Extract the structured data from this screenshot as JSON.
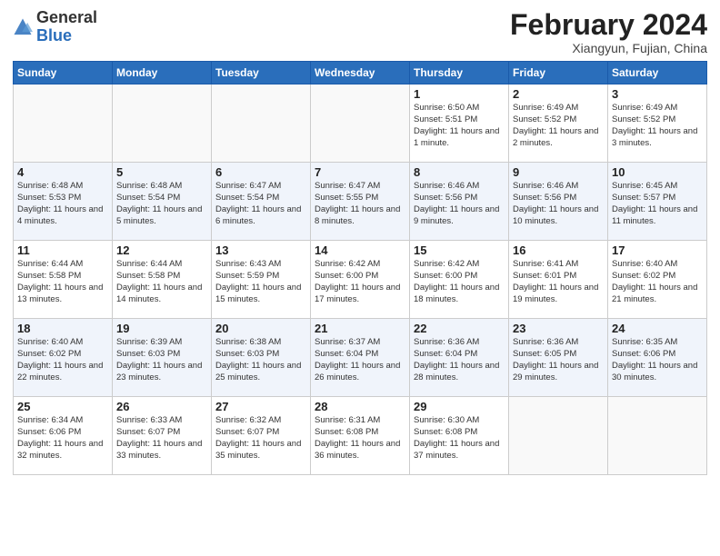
{
  "header": {
    "logo_general": "General",
    "logo_blue": "Blue",
    "month_title": "February 2024",
    "subtitle": "Xiangyun, Fujian, China"
  },
  "weekdays": [
    "Sunday",
    "Monday",
    "Tuesday",
    "Wednesday",
    "Thursday",
    "Friday",
    "Saturday"
  ],
  "weeks": [
    [
      {
        "day": "",
        "info": ""
      },
      {
        "day": "",
        "info": ""
      },
      {
        "day": "",
        "info": ""
      },
      {
        "day": "",
        "info": ""
      },
      {
        "day": "1",
        "info": "Sunrise: 6:50 AM\nSunset: 5:51 PM\nDaylight: 11 hours and 1 minute."
      },
      {
        "day": "2",
        "info": "Sunrise: 6:49 AM\nSunset: 5:52 PM\nDaylight: 11 hours and 2 minutes."
      },
      {
        "day": "3",
        "info": "Sunrise: 6:49 AM\nSunset: 5:52 PM\nDaylight: 11 hours and 3 minutes."
      }
    ],
    [
      {
        "day": "4",
        "info": "Sunrise: 6:48 AM\nSunset: 5:53 PM\nDaylight: 11 hours and 4 minutes."
      },
      {
        "day": "5",
        "info": "Sunrise: 6:48 AM\nSunset: 5:54 PM\nDaylight: 11 hours and 5 minutes."
      },
      {
        "day": "6",
        "info": "Sunrise: 6:47 AM\nSunset: 5:54 PM\nDaylight: 11 hours and 6 minutes."
      },
      {
        "day": "7",
        "info": "Sunrise: 6:47 AM\nSunset: 5:55 PM\nDaylight: 11 hours and 8 minutes."
      },
      {
        "day": "8",
        "info": "Sunrise: 6:46 AM\nSunset: 5:56 PM\nDaylight: 11 hours and 9 minutes."
      },
      {
        "day": "9",
        "info": "Sunrise: 6:46 AM\nSunset: 5:56 PM\nDaylight: 11 hours and 10 minutes."
      },
      {
        "day": "10",
        "info": "Sunrise: 6:45 AM\nSunset: 5:57 PM\nDaylight: 11 hours and 11 minutes."
      }
    ],
    [
      {
        "day": "11",
        "info": "Sunrise: 6:44 AM\nSunset: 5:58 PM\nDaylight: 11 hours and 13 minutes."
      },
      {
        "day": "12",
        "info": "Sunrise: 6:44 AM\nSunset: 5:58 PM\nDaylight: 11 hours and 14 minutes."
      },
      {
        "day": "13",
        "info": "Sunrise: 6:43 AM\nSunset: 5:59 PM\nDaylight: 11 hours and 15 minutes."
      },
      {
        "day": "14",
        "info": "Sunrise: 6:42 AM\nSunset: 6:00 PM\nDaylight: 11 hours and 17 minutes."
      },
      {
        "day": "15",
        "info": "Sunrise: 6:42 AM\nSunset: 6:00 PM\nDaylight: 11 hours and 18 minutes."
      },
      {
        "day": "16",
        "info": "Sunrise: 6:41 AM\nSunset: 6:01 PM\nDaylight: 11 hours and 19 minutes."
      },
      {
        "day": "17",
        "info": "Sunrise: 6:40 AM\nSunset: 6:02 PM\nDaylight: 11 hours and 21 minutes."
      }
    ],
    [
      {
        "day": "18",
        "info": "Sunrise: 6:40 AM\nSunset: 6:02 PM\nDaylight: 11 hours and 22 minutes."
      },
      {
        "day": "19",
        "info": "Sunrise: 6:39 AM\nSunset: 6:03 PM\nDaylight: 11 hours and 23 minutes."
      },
      {
        "day": "20",
        "info": "Sunrise: 6:38 AM\nSunset: 6:03 PM\nDaylight: 11 hours and 25 minutes."
      },
      {
        "day": "21",
        "info": "Sunrise: 6:37 AM\nSunset: 6:04 PM\nDaylight: 11 hours and 26 minutes."
      },
      {
        "day": "22",
        "info": "Sunrise: 6:36 AM\nSunset: 6:04 PM\nDaylight: 11 hours and 28 minutes."
      },
      {
        "day": "23",
        "info": "Sunrise: 6:36 AM\nSunset: 6:05 PM\nDaylight: 11 hours and 29 minutes."
      },
      {
        "day": "24",
        "info": "Sunrise: 6:35 AM\nSunset: 6:06 PM\nDaylight: 11 hours and 30 minutes."
      }
    ],
    [
      {
        "day": "25",
        "info": "Sunrise: 6:34 AM\nSunset: 6:06 PM\nDaylight: 11 hours and 32 minutes."
      },
      {
        "day": "26",
        "info": "Sunrise: 6:33 AM\nSunset: 6:07 PM\nDaylight: 11 hours and 33 minutes."
      },
      {
        "day": "27",
        "info": "Sunrise: 6:32 AM\nSunset: 6:07 PM\nDaylight: 11 hours and 35 minutes."
      },
      {
        "day": "28",
        "info": "Sunrise: 6:31 AM\nSunset: 6:08 PM\nDaylight: 11 hours and 36 minutes."
      },
      {
        "day": "29",
        "info": "Sunrise: 6:30 AM\nSunset: 6:08 PM\nDaylight: 11 hours and 37 minutes."
      },
      {
        "day": "",
        "info": ""
      },
      {
        "day": "",
        "info": ""
      }
    ]
  ]
}
